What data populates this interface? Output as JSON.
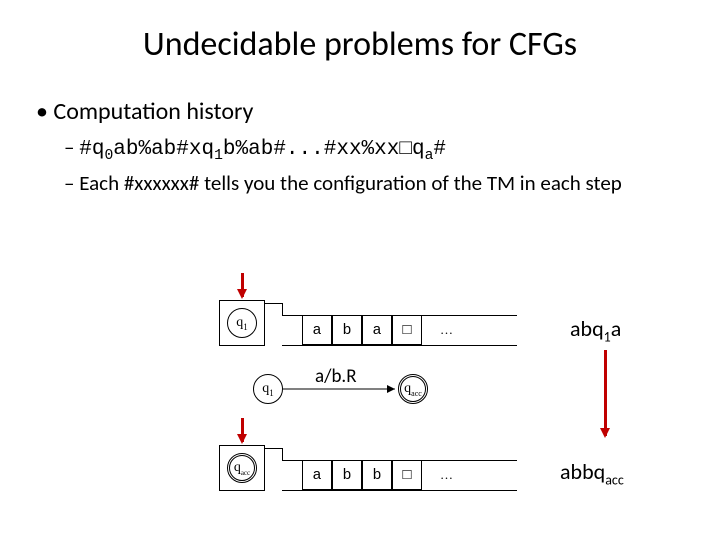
{
  "title": "Undecidable problems for CFGs",
  "bullets": {
    "main": "Computation history",
    "sub1_pre": "#q",
    "sub1_s1": "0",
    "sub1_a": "ab%ab#xq",
    "sub1_s2": "1",
    "sub1_b": "b%ab#...#xx%xx□q",
    "sub1_s3": "a",
    "sub1_c": "#",
    "sub2": "Each #xxxxxx# tells you the configuration of the TM in each step"
  },
  "states": {
    "q1": "q",
    "q1_sub": "1",
    "q1b": "q",
    "q1b_sub": "1",
    "qacc": "q",
    "qacc_sub": "acc",
    "qacc2": "q",
    "qacc2_sub": "acc"
  },
  "tape1": {
    "c0": "a",
    "c1": "b",
    "c2": "a",
    "c3": "□"
  },
  "tape2": {
    "c0": "a",
    "c1": "b",
    "c2": "b",
    "c3": "□"
  },
  "ellipsis": "…",
  "trans": "a/b.R",
  "label1_pre": "abq",
  "label1_sub": "1",
  "label1_post": "a",
  "label2_pre": "abbq",
  "label2_sub": "acc"
}
